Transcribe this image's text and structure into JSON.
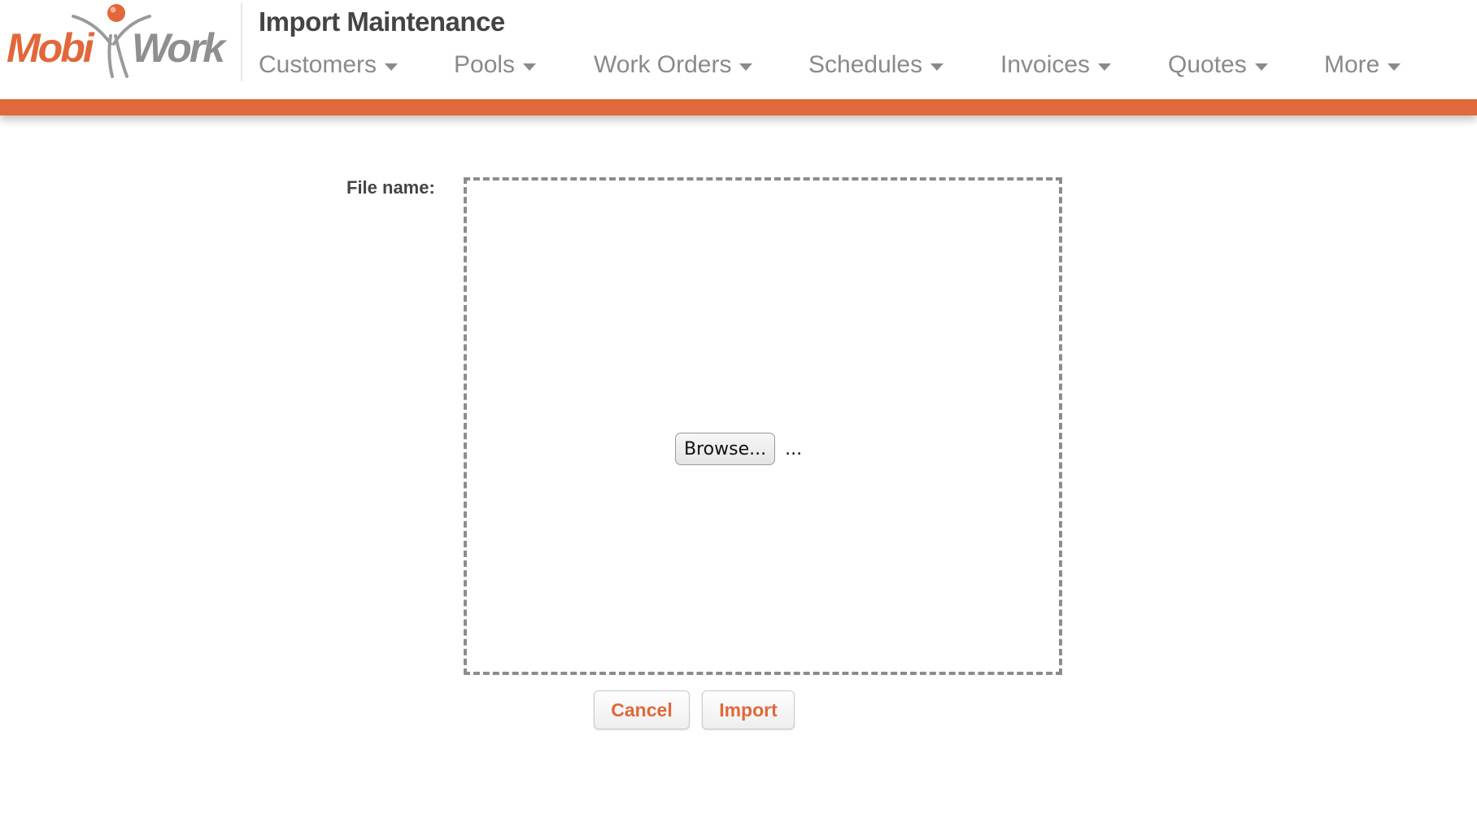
{
  "brand": {
    "logo_text_left": "Mobi",
    "logo_text_right": "Work",
    "colors": {
      "accent": "#e0683a",
      "logo_gray": "#8f8f8f",
      "title": "#444444",
      "nav": "#8a8a8a"
    }
  },
  "header": {
    "title": "Import Maintenance"
  },
  "nav": {
    "items": [
      {
        "label": "Customers",
        "icon": "chevron-down-icon"
      },
      {
        "label": "Pools",
        "icon": "chevron-down-icon"
      },
      {
        "label": "Work Orders",
        "icon": "chevron-down-icon"
      },
      {
        "label": "Schedules",
        "icon": "chevron-down-icon"
      },
      {
        "label": "Invoices",
        "icon": "chevron-down-icon"
      },
      {
        "label": "Quotes",
        "icon": "chevron-down-icon"
      },
      {
        "label": "More",
        "icon": "chevron-down-icon"
      }
    ]
  },
  "form": {
    "file_label": "File name:",
    "browse_label": "Browse...",
    "file_status": "..."
  },
  "actions": {
    "cancel_label": "Cancel",
    "import_label": "Import"
  }
}
